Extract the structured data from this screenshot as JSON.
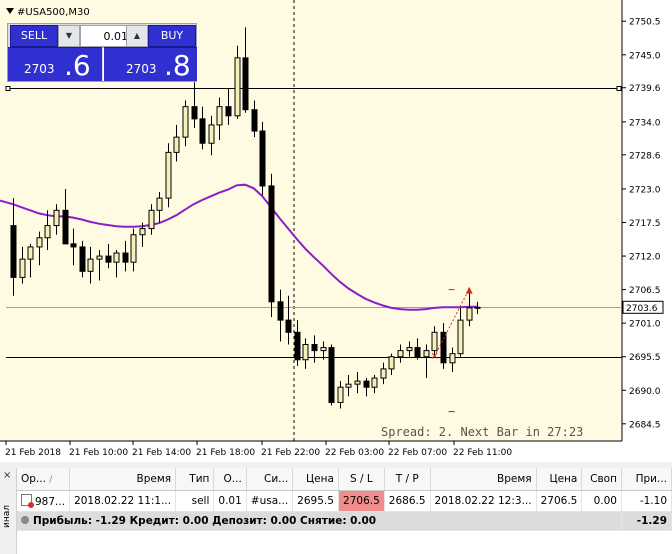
{
  "chart": {
    "symbol": "#USA500,M30",
    "spread_text": "Spread: 2.  Next Bar in 27:23",
    "current_price_label": "2703.6",
    "price_ticks": [
      "2750.5",
      "2745.0",
      "2739.6",
      "2734.0",
      "2728.6",
      "2723.0",
      "2717.5",
      "2712.0",
      "2706.5",
      "2701.0",
      "2695.5",
      "2690.0",
      "2684.5"
    ],
    "time_ticks": [
      "21 Feb 2018",
      "21 Feb 10:00",
      "21 Feb 14:00",
      "21 Feb 18:00",
      "21 Feb 22:00",
      "22 Feb 03:00",
      "22 Feb 07:00",
      "22 Feb 11:00"
    ],
    "colors": {
      "background": "#fffbe2",
      "bull_fill": "#f5f0b8",
      "bear_fill": "#000000",
      "moving_average": "#8a1ec8",
      "sl_marker": "#c03010",
      "tp_marker": "#3030d0",
      "trade_line": "#d03010"
    }
  },
  "trade_panel": {
    "sell_label": "SELL",
    "buy_label": "BUY",
    "lot_value": "0.01",
    "sell_price_small": "2703",
    "sell_price_big": ".6",
    "buy_price_small": "2703",
    "buy_price_big": ".8"
  },
  "terminal": {
    "side_label": "инал",
    "close_glyph": "×",
    "headers": [
      "Ор...",
      "Время",
      "Тип",
      "О...",
      "Си...",
      "Цена",
      "S / L",
      "T / P",
      "Время",
      "Цена",
      "Своп",
      "При..."
    ],
    "sort_glyph": "/",
    "order": {
      "ticket": "987...",
      "open_time": "2018.02.22 11:1...",
      "type": "sell",
      "volume": "0.01",
      "symbol": "#usa...",
      "open_price": "2695.5",
      "sl": "2706.5",
      "tp": "2686.5",
      "time": "2018.02.22 12:3...",
      "price": "2706.5",
      "swap": "0.00",
      "profit": "-1.10"
    },
    "summary": {
      "text": "Прибыль: -1.29  Кредит: 0.00  Депозит: 0.00  Снятие: 0.00",
      "total": "-1.29"
    }
  },
  "chart_data": {
    "type": "candlestick",
    "timeframe": "M30",
    "ohlc": [
      [
        2717.0,
        2721.5,
        2705.5,
        2708.5
      ],
      [
        2708.5,
        2713.5,
        2707.5,
        2711.5
      ],
      [
        2711.5,
        2714.0,
        2708.5,
        2713.5
      ],
      [
        2713.5,
        2716.0,
        2710.5,
        2715.0
      ],
      [
        2715.0,
        2719.5,
        2713.0,
        2717.0
      ],
      [
        2717.0,
        2720.5,
        2715.5,
        2719.5
      ],
      [
        2719.5,
        2723.0,
        2716.5,
        2714.0
      ],
      [
        2714.0,
        2716.5,
        2710.5,
        2713.5
      ],
      [
        2713.5,
        2714.5,
        2708.5,
        2709.5
      ],
      [
        2709.5,
        2713.5,
        2707.5,
        2711.5
      ],
      [
        2711.5,
        2713.0,
        2708.0,
        2712.0
      ],
      [
        2712.0,
        2714.0,
        2710.0,
        2711.0
      ],
      [
        2711.0,
        2713.0,
        2708.5,
        2712.5
      ],
      [
        2712.5,
        2714.5,
        2709.5,
        2711.0
      ],
      [
        2711.0,
        2716.5,
        2709.5,
        2715.5
      ],
      [
        2715.5,
        2717.5,
        2713.5,
        2716.5
      ],
      [
        2716.5,
        2720.5,
        2715.5,
        2719.5
      ],
      [
        2719.5,
        2722.5,
        2717.5,
        2721.5
      ],
      [
        2721.5,
        2730.5,
        2720.0,
        2729.0
      ],
      [
        2729.0,
        2733.5,
        2727.5,
        2731.5
      ],
      [
        2731.5,
        2737.5,
        2730.0,
        2736.5
      ],
      [
        2736.5,
        2740.5,
        2733.0,
        2734.5
      ],
      [
        2734.5,
        2736.5,
        2729.5,
        2730.5
      ],
      [
        2730.5,
        2735.0,
        2728.5,
        2733.5
      ],
      [
        2733.5,
        2738.0,
        2731.0,
        2736.5
      ],
      [
        2736.5,
        2739.5,
        2733.5,
        2735.0
      ],
      [
        2735.0,
        2746.5,
        2734.5,
        2744.5
      ],
      [
        2744.5,
        2749.5,
        2735.5,
        2736.0
      ],
      [
        2736.0,
        2737.5,
        2731.5,
        2732.5
      ],
      [
        2732.5,
        2734.0,
        2722.0,
        2723.5
      ],
      [
        2723.5,
        2725.5,
        2702.0,
        2704.5
      ],
      [
        2704.5,
        2706.5,
        2698.0,
        2701.5
      ],
      [
        2701.5,
        2705.5,
        2697.5,
        2699.5
      ],
      [
        2699.5,
        2701.5,
        2694.0,
        2695.0
      ],
      [
        2695.0,
        2698.5,
        2693.5,
        2697.5
      ],
      [
        2697.5,
        2699.0,
        2694.5,
        2696.5
      ],
      [
        2696.5,
        2698.0,
        2695.0,
        2697.0
      ],
      [
        2697.0,
        2697.5,
        2687.5,
        2688.0
      ],
      [
        2688.0,
        2691.5,
        2687.0,
        2690.5
      ],
      [
        2690.5,
        2692.5,
        2689.0,
        2691.0
      ],
      [
        2691.0,
        2693.0,
        2689.5,
        2691.5
      ],
      [
        2691.5,
        2692.0,
        2689.0,
        2690.5
      ],
      [
        2690.5,
        2692.5,
        2689.5,
        2692.0
      ],
      [
        2692.0,
        2694.5,
        2691.0,
        2693.5
      ],
      [
        2693.5,
        2696.0,
        2692.5,
        2695.5
      ],
      [
        2695.5,
        2697.5,
        2694.5,
        2696.5
      ],
      [
        2696.5,
        2698.0,
        2695.5,
        2697.0
      ],
      [
        2697.0,
        2698.5,
        2695.0,
        2695.5
      ],
      [
        2695.5,
        2697.5,
        2692.0,
        2696.5
      ],
      [
        2696.5,
        2700.5,
        2695.5,
        2699.5
      ],
      [
        2699.5,
        2701.0,
        2693.5,
        2694.5
      ],
      [
        2694.5,
        2697.0,
        2693.0,
        2696.0
      ],
      [
        2696.0,
        2703.5,
        2695.5,
        2701.5
      ],
      [
        2701.5,
        2706.5,
        2700.5,
        2703.5
      ],
      [
        2703.5,
        2704.5,
        2702.5,
        2703.6
      ]
    ],
    "moving_average": [
      2720.5,
      2720.0,
      2719.5,
      2719.0,
      2718.7,
      2718.5,
      2718.5,
      2718.3,
      2718.0,
      2717.6,
      2717.3,
      2717.1,
      2716.9,
      2716.8,
      2716.8,
      2716.9,
      2717.1,
      2717.4,
      2718.0,
      2718.7,
      2719.6,
      2720.5,
      2721.2,
      2721.8,
      2722.4,
      2722.9,
      2723.6,
      2723.7,
      2723.1,
      2721.8,
      2720.0,
      2718.2,
      2716.5,
      2714.8,
      2713.2,
      2711.8,
      2710.5,
      2709.1,
      2707.8,
      2706.7,
      2705.8,
      2705.0,
      2704.4,
      2703.9,
      2703.5,
      2703.3,
      2703.2,
      2703.2,
      2703.3,
      2703.5,
      2703.6,
      2703.6,
      2703.6,
      2703.7,
      2703.7
    ],
    "horizontal_lines": [
      2739.6,
      2703.6,
      2695.5
    ],
    "order": {
      "type": "sell",
      "open_price": 2695.5,
      "stop_loss": 2706.5,
      "take_profit": 2686.5,
      "close_price": 2706.5
    },
    "ylim": [
      2682.5,
      2753.0
    ]
  }
}
